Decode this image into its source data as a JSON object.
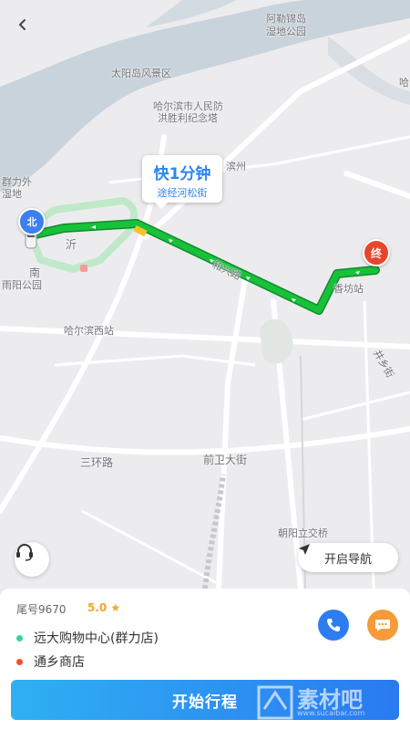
{
  "map": {
    "labels": {
      "amuer": "阿勒锦岛",
      "wetland_park": "湿地公园",
      "sun_island": "太阳岛风景区",
      "memorial_1": "哈尔滨市人民防",
      "memorial_2": "洪胜利纪念塔",
      "binzhou": "滨州",
      "qunli_1": "群力外",
      "qunli_2": "湿地",
      "hongqi": "沂",
      "south": "南",
      "nanyang_park": "雨阳公园",
      "xiangfang": "香坊站",
      "west_station": "哈尔滨西站",
      "third_ring": "三环路",
      "qianwei": "前卫大街",
      "chaoyang": "朝阳立交桥",
      "road_heping": "和兴路",
      "jingxiang": "哈",
      "side_road": "井乡街"
    },
    "callout": {
      "title": "快1分钟",
      "subtitle": "途经河松街"
    },
    "start_marker": "北",
    "end_marker": "终"
  },
  "nav_button_label": "开启导航",
  "driver": {
    "plate": "尾号9670",
    "rating": "5.0 ★"
  },
  "trip": {
    "origin": "远大购物中心(群力店)",
    "destination": "通乡商店"
  },
  "start_trip_label": "开始行程",
  "watermark": {
    "main": "素材吧",
    "sub": "www.sucaibar.com"
  },
  "colors": {
    "route": "#17b936",
    "accent": "#2c7ef0",
    "origin_dot": "#3ccf9e",
    "dest_dot": "#f0502c",
    "rating": "#f4a623"
  }
}
